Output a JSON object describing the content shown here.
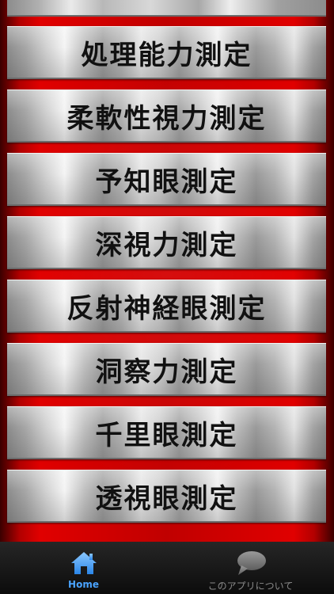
{
  "menu": {
    "items": [
      {
        "label": "処理能力測定"
      },
      {
        "label": "柔軟性視力測定"
      },
      {
        "label": "予知眼測定"
      },
      {
        "label": "深視力測定"
      },
      {
        "label": "反射神経眼測定"
      },
      {
        "label": "洞察力測定"
      },
      {
        "label": "千里眼測定"
      },
      {
        "label": "透視眼測定"
      }
    ]
  },
  "tabbar": {
    "home": {
      "label": "Home",
      "icon": "home-icon"
    },
    "about": {
      "label": "このアプリについて",
      "icon": "speech-bubble-icon"
    }
  },
  "colors": {
    "accent": "#4aa3ff",
    "background_red": "#d00000",
    "tab_inactive": "#8a8a8a"
  }
}
